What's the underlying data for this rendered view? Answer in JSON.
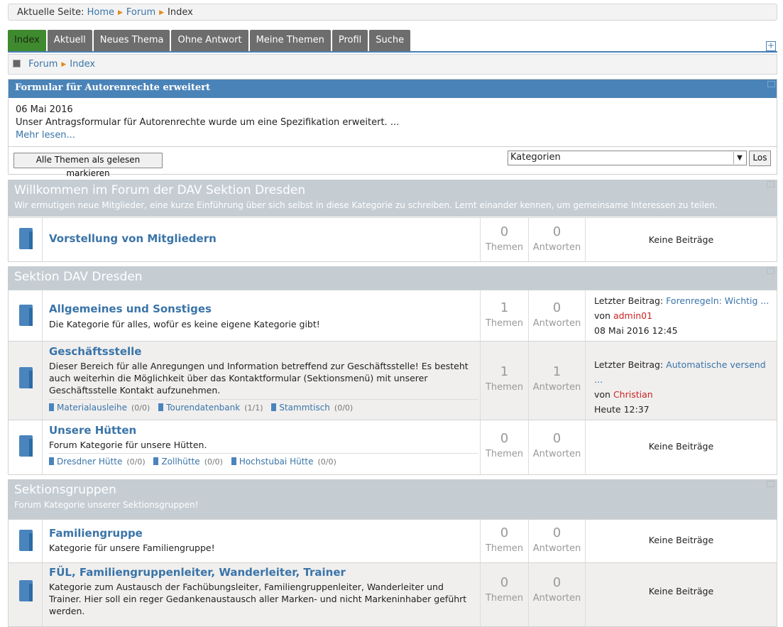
{
  "breadcrumb": {
    "prefix": "Aktuelle Seite:",
    "items": [
      "Home",
      "Forum",
      "Index"
    ]
  },
  "tabs": [
    "Index",
    "Aktuell",
    "Neues Thema",
    "Ohne Antwort",
    "Meine Themen",
    "Profil",
    "Suche"
  ],
  "subnav": {
    "items": [
      "Forum",
      "Index"
    ]
  },
  "news": {
    "title": "Formular für Autorenrechte erweitert",
    "date": "06 Mai 2016",
    "text": "Unser Antragsformular für Autorenrechte wurde um eine Spezifikation erweitert. ...",
    "more": "Mehr lesen..."
  },
  "controls": {
    "mark_read": "Alle Themen als gelesen markieren",
    "select_value": "Kategorien",
    "go": "Los"
  },
  "labels": {
    "topics": "Themen",
    "replies": "Antworten",
    "no_posts": "Keine Beiträge",
    "last_post": "Letzter Beitrag:",
    "by": "von"
  },
  "categories": [
    {
      "title": "Willkommen im Forum der DAV Sektion Dresden",
      "desc": "Wir ermutigen neue Mitglieder, eine kurze Einführung über sich selbst in diese Kategorie zu schreiben. Lernt einander kennen, um gemeinsame Interessen zu teilen.",
      "forums": [
        {
          "title": "Vorstellung von Mitgliedern",
          "topics": "0",
          "replies": "0"
        }
      ]
    },
    {
      "title": "Sektion DAV Dresden",
      "forums": [
        {
          "title": "Allgemeines und Sonstiges",
          "desc": "Die Kategorie für alles, wofür es keine eigene Kategorie gibt!",
          "topics": "1",
          "replies": "0",
          "last_topic": "Forenregeln: Wichtig ...",
          "last_user": "admin01",
          "last_time": "08 Mai 2016 12:45"
        },
        {
          "title": "Geschäftsstelle",
          "desc": "Dieser Bereich für alle Anregungen und Information betreffend zur Geschäftsstelle! Es besteht auch weiterhin die Möglichkeit über das Kontaktformular (Sektionsmenü) mit unserer Geschäftsstelle Kontakt aufzunehmen.",
          "topics": "1",
          "replies": "1",
          "last_topic": "Automatische versend ...",
          "last_user": "Christian",
          "last_time": "Heute 12:37",
          "subforums": [
            {
              "name": "Materialausleihe",
              "count": "(0/0)"
            },
            {
              "name": "Tourendatenbank",
              "count": "(1/1)"
            },
            {
              "name": "Stammtisch",
              "count": "(0/0)"
            }
          ]
        },
        {
          "title": "Unsere Hütten",
          "desc": "Forum Kategorie für unsere Hütten.",
          "topics": "0",
          "replies": "0",
          "subforums": [
            {
              "name": "Dresdner Hütte",
              "count": "(0/0)"
            },
            {
              "name": "Zollhütte",
              "count": "(0/0)"
            },
            {
              "name": "Hochstubai Hütte",
              "count": "(0/0)"
            }
          ]
        }
      ]
    },
    {
      "title": "Sektionsgruppen",
      "desc": "Forum Kategorie unserer Sektionsgruppen!",
      "forums": [
        {
          "title": "Familiengruppe",
          "desc": "Kategorie für unsere Familiengruppe!",
          "topics": "0",
          "replies": "0"
        },
        {
          "title": "FÜL, Familiengruppenleiter, Wanderleiter, Trainer",
          "desc": "Kategorie zum Austausch der Fachübungsleiter, Familiengruppenleiter, Wanderleiter und Trainer. Hier soll ein reger Gedankenaustausch aller Marken- und nicht Markeninhaber geführt werden.",
          "topics": "0",
          "replies": "0"
        }
      ]
    }
  ]
}
